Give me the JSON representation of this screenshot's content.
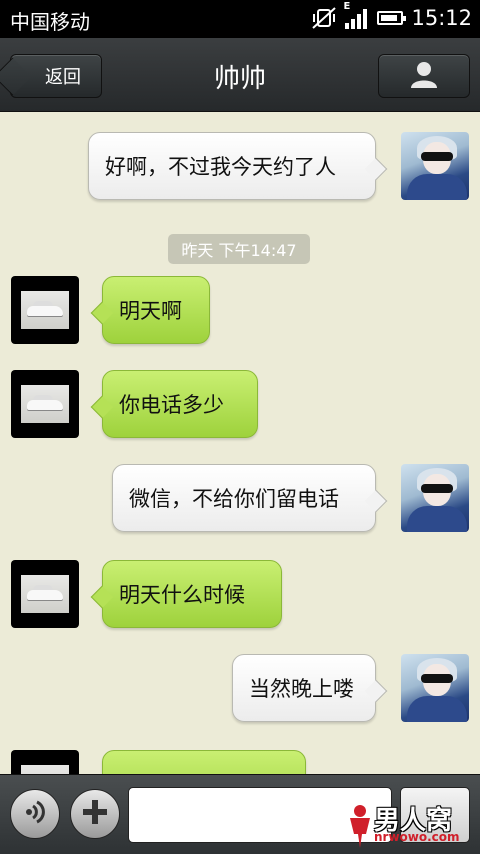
{
  "status_bar": {
    "carrier": "中国移动",
    "time": "15:12",
    "network_label": "E"
  },
  "header": {
    "back_label": "返回",
    "title": "帅帅",
    "profile_icon": "person-icon"
  },
  "timestamp": "昨天 下午14:47",
  "messages": [
    {
      "side": "right",
      "sender": "self",
      "text": "好啊，不过我今天约了人"
    },
    {
      "side": "left",
      "sender": "other",
      "text": "明天啊"
    },
    {
      "side": "left",
      "sender": "other",
      "text": "你电话多少"
    },
    {
      "side": "right",
      "sender": "self",
      "text": "微信，不给你们留电话"
    },
    {
      "side": "left",
      "sender": "other",
      "text": "明天什么时候"
    },
    {
      "side": "right",
      "sender": "self",
      "text": "当然晚上喽"
    },
    {
      "side": "left",
      "sender": "other",
      "text": ""
    }
  ],
  "input_bar": {
    "voice_icon": "voice-icon",
    "plus_icon": "plus-icon",
    "input_value": "",
    "input_placeholder": ""
  },
  "watermark": {
    "main": "男人窝",
    "sub": "nrwowo.com"
  },
  "colors": {
    "background": "#ecebd7",
    "bubble_green": "#b5e156",
    "bubble_white": "#f8f8f8",
    "header": "#2f3335"
  }
}
